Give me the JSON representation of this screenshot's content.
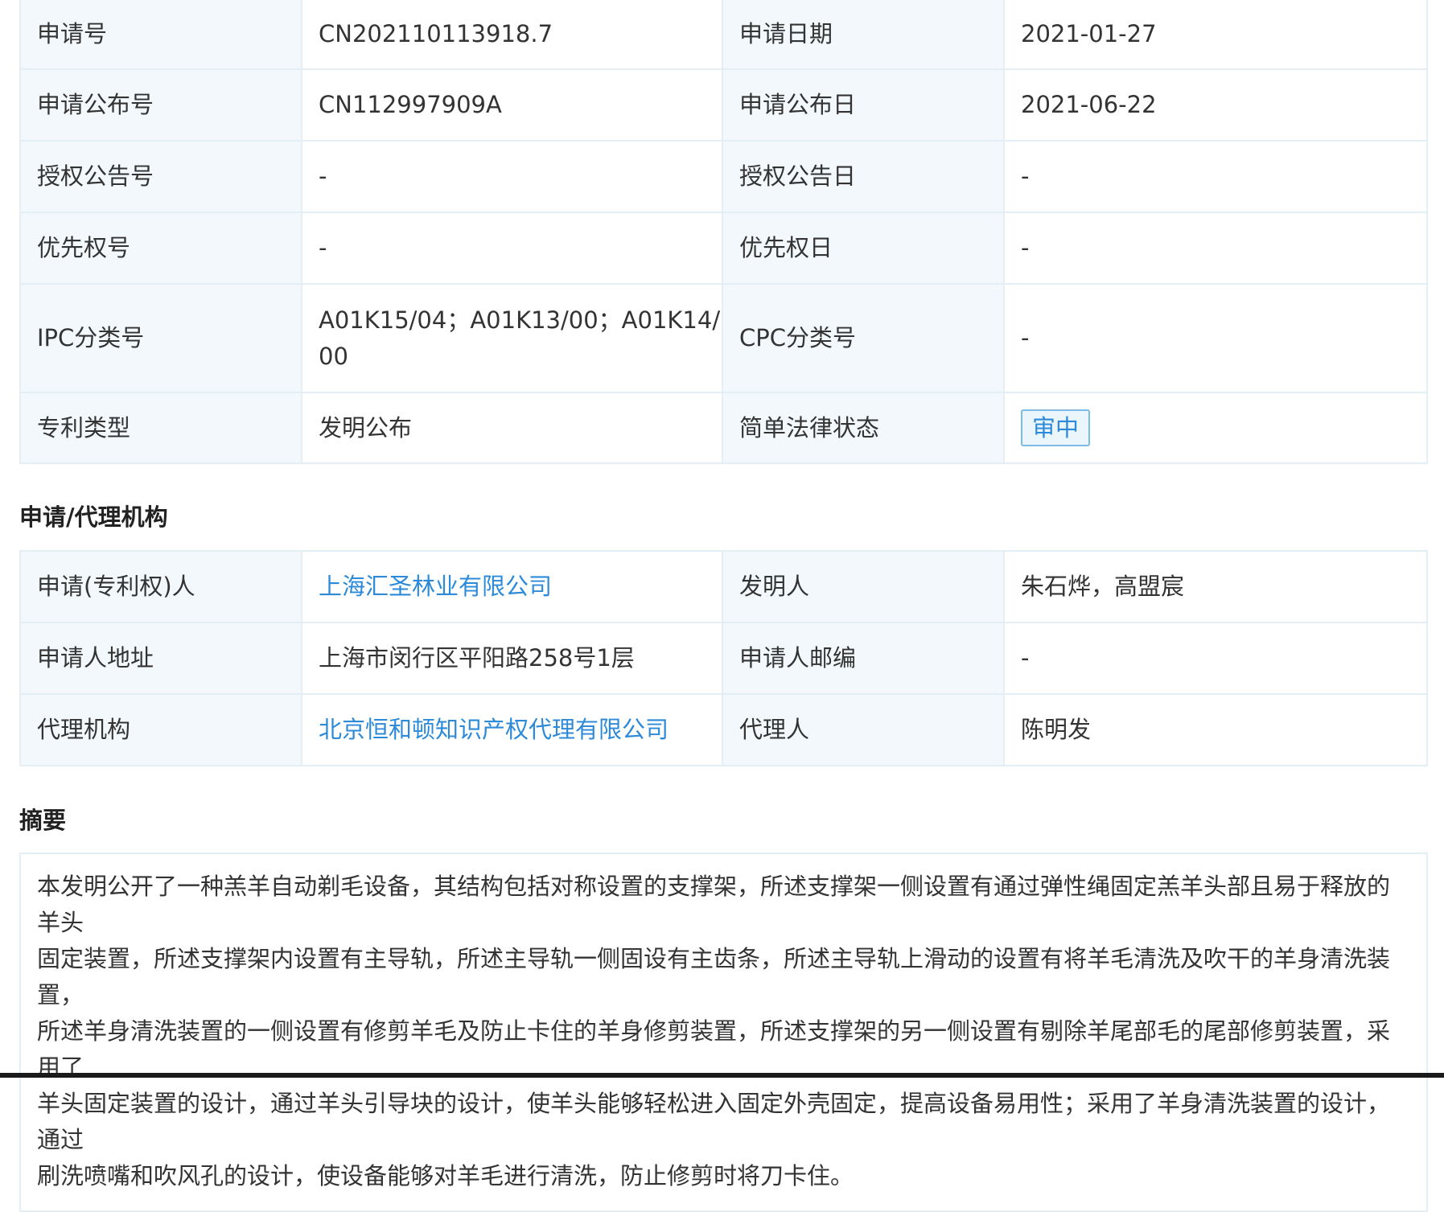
{
  "basic_info": {
    "rows": [
      {
        "label1": "申请号",
        "value1": "CN202110113918.7",
        "label2": "申请日期",
        "value2": "2021-01-27"
      },
      {
        "label1": "申请公布号",
        "value1": "CN112997909A",
        "label2": "申请公布日",
        "value2": "2021-06-22"
      },
      {
        "label1": "授权公告号",
        "value1": "-",
        "label2": "授权公告日",
        "value2": "-"
      },
      {
        "label1": "优先权号",
        "value1": "-",
        "label2": "优先权日",
        "value2": "-"
      },
      {
        "label1": "IPC分类号",
        "value1_line1": "A01K15/04；A01K13/00；A01K14/",
        "value1_line2": "00",
        "label2": "CPC分类号",
        "value2": "-"
      },
      {
        "label1": "专利类型",
        "value1": "发明公布",
        "label2": "简单法律状态",
        "status_badge": "审中"
      }
    ]
  },
  "agency": {
    "title": "申请/代理机构",
    "rows": [
      {
        "label1": "申请(专利权)人",
        "value1": "上海汇圣林业有限公司",
        "label2": "发明人",
        "value2": "朱石烨，高盟宸"
      },
      {
        "label1": "申请人地址",
        "value1": "上海市闵行区平阳路258号1层",
        "label2": "申请人邮编",
        "value2": "-"
      },
      {
        "label1": "代理机构",
        "value1": "北京恒和顿知识产权代理有限公司",
        "label2": "代理人",
        "value2": "陈明发"
      }
    ]
  },
  "abstract": {
    "title": "摘要",
    "lines": [
      "本发明公开了一种羔羊自动剃毛设备，其结构包括对称设置的支撑架，所述支撑架一侧设置有通过弹性绳固定羔羊头部且易于释放的羊头",
      "固定装置，所述支撑架内设置有主导轨，所述主导轨一侧固设有主齿条，所述主导轨上滑动的设置有将羊毛清洗及吹干的羊身清洗装置，",
      "所述羊身清洗装置的一侧设置有修剪羊毛及防止卡住的羊身修剪装置，所述支撑架的另一侧设置有剔除羊尾部毛的尾部修剪装置，采用了",
      "羊头固定装置的设计，通过羊头引导块的设计，使羊头能够轻松进入固定外壳固定，提高设备易用性；采用了羊身清洗装置的设计，通过",
      "刷洗喷嘴和吹风孔的设计，使设备能够对羊毛进行清洗，防止修剪时将刀卡住。"
    ]
  },
  "colors": {
    "label_bg": "#f2f8fb",
    "border": "#e3eef5",
    "link": "#2c8ad8",
    "badge_border": "#7dbbe6"
  }
}
